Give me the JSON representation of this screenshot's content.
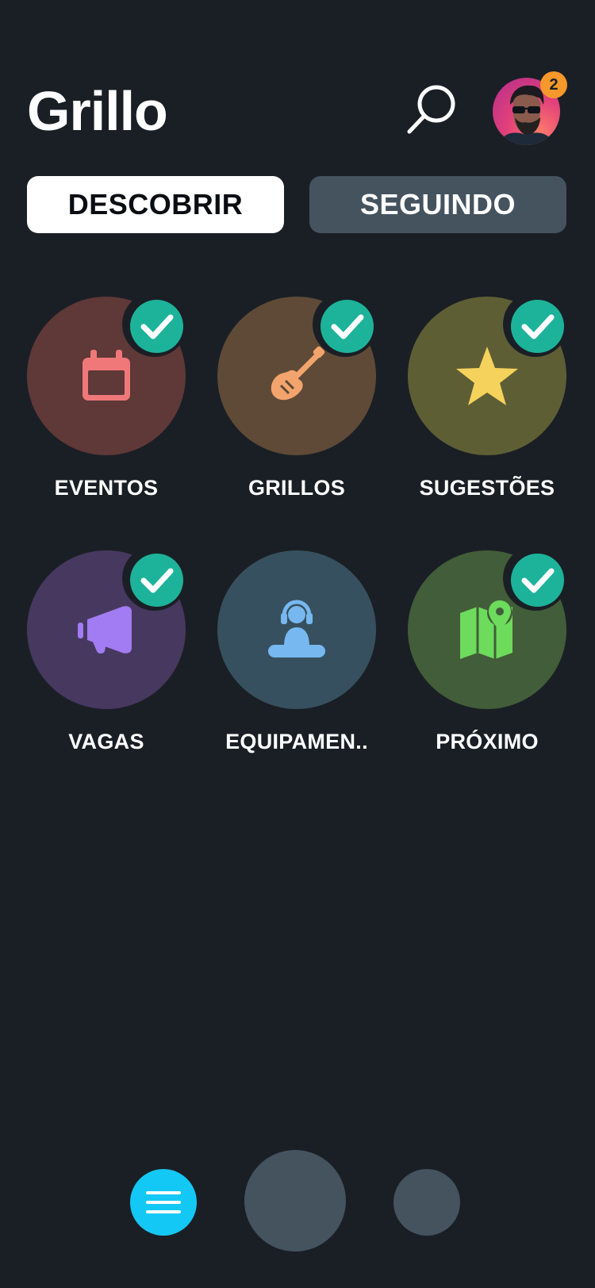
{
  "header": {
    "app_title": "Grillo",
    "notification_count": "2"
  },
  "tabs": {
    "discover": "DESCOBRIR",
    "following": "SEGUINDO"
  },
  "categories": [
    {
      "label": "EVENTOS",
      "icon": "calendar-icon",
      "bg": "#5f3838",
      "color": "#f07878",
      "checked": true
    },
    {
      "label": "GRILLOS",
      "icon": "guitar-icon",
      "bg": "#5e4a36",
      "color": "#f3a46d",
      "checked": true
    },
    {
      "label": "SUGESTÕES",
      "icon": "star-icon",
      "bg": "#5e5e35",
      "color": "#f5d25c",
      "checked": true
    },
    {
      "label": "VAGAS",
      "icon": "megaphone-icon",
      "bg": "#473860",
      "color": "#a27cf2",
      "checked": true
    },
    {
      "label": "EQUIPAMEN..",
      "icon": "meditation-headphones-icon",
      "bg": "#37505f",
      "color": "#76b8ef",
      "checked": false
    },
    {
      "label": "PRÓXIMO",
      "icon": "map-pin-icon",
      "bg": "#425d39",
      "color": "#6ddb5c",
      "checked": true
    }
  ],
  "colors": {
    "background": "#1a1f25",
    "check_green": "#1db39a",
    "accent_blue": "#14c8f6",
    "badge_orange": "#f7982a"
  }
}
